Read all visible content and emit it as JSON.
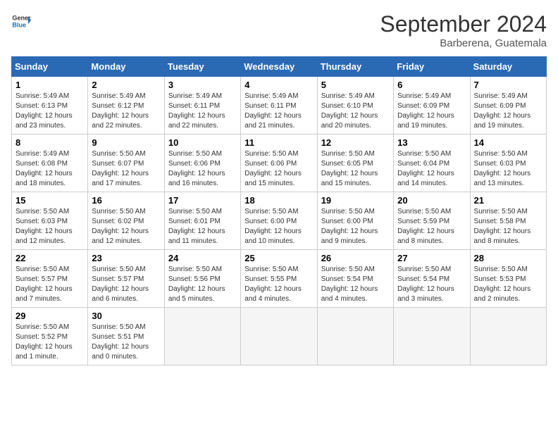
{
  "header": {
    "logo_line1": "General",
    "logo_line2": "Blue",
    "month": "September 2024",
    "location": "Barberena, Guatemala"
  },
  "weekdays": [
    "Sunday",
    "Monday",
    "Tuesday",
    "Wednesday",
    "Thursday",
    "Friday",
    "Saturday"
  ],
  "weeks": [
    [
      {
        "day": "1",
        "info": "Sunrise: 5:49 AM\nSunset: 6:13 PM\nDaylight: 12 hours\nand 23 minutes."
      },
      {
        "day": "2",
        "info": "Sunrise: 5:49 AM\nSunset: 6:12 PM\nDaylight: 12 hours\nand 22 minutes."
      },
      {
        "day": "3",
        "info": "Sunrise: 5:49 AM\nSunset: 6:11 PM\nDaylight: 12 hours\nand 22 minutes."
      },
      {
        "day": "4",
        "info": "Sunrise: 5:49 AM\nSunset: 6:11 PM\nDaylight: 12 hours\nand 21 minutes."
      },
      {
        "day": "5",
        "info": "Sunrise: 5:49 AM\nSunset: 6:10 PM\nDaylight: 12 hours\nand 20 minutes."
      },
      {
        "day": "6",
        "info": "Sunrise: 5:49 AM\nSunset: 6:09 PM\nDaylight: 12 hours\nand 19 minutes."
      },
      {
        "day": "7",
        "info": "Sunrise: 5:49 AM\nSunset: 6:09 PM\nDaylight: 12 hours\nand 19 minutes."
      }
    ],
    [
      {
        "day": "8",
        "info": "Sunrise: 5:49 AM\nSunset: 6:08 PM\nDaylight: 12 hours\nand 18 minutes."
      },
      {
        "day": "9",
        "info": "Sunrise: 5:50 AM\nSunset: 6:07 PM\nDaylight: 12 hours\nand 17 minutes."
      },
      {
        "day": "10",
        "info": "Sunrise: 5:50 AM\nSunset: 6:06 PM\nDaylight: 12 hours\nand 16 minutes."
      },
      {
        "day": "11",
        "info": "Sunrise: 5:50 AM\nSunset: 6:06 PM\nDaylight: 12 hours\nand 15 minutes."
      },
      {
        "day": "12",
        "info": "Sunrise: 5:50 AM\nSunset: 6:05 PM\nDaylight: 12 hours\nand 15 minutes."
      },
      {
        "day": "13",
        "info": "Sunrise: 5:50 AM\nSunset: 6:04 PM\nDaylight: 12 hours\nand 14 minutes."
      },
      {
        "day": "14",
        "info": "Sunrise: 5:50 AM\nSunset: 6:03 PM\nDaylight: 12 hours\nand 13 minutes."
      }
    ],
    [
      {
        "day": "15",
        "info": "Sunrise: 5:50 AM\nSunset: 6:03 PM\nDaylight: 12 hours\nand 12 minutes."
      },
      {
        "day": "16",
        "info": "Sunrise: 5:50 AM\nSunset: 6:02 PM\nDaylight: 12 hours\nand 12 minutes."
      },
      {
        "day": "17",
        "info": "Sunrise: 5:50 AM\nSunset: 6:01 PM\nDaylight: 12 hours\nand 11 minutes."
      },
      {
        "day": "18",
        "info": "Sunrise: 5:50 AM\nSunset: 6:00 PM\nDaylight: 12 hours\nand 10 minutes."
      },
      {
        "day": "19",
        "info": "Sunrise: 5:50 AM\nSunset: 6:00 PM\nDaylight: 12 hours\nand 9 minutes."
      },
      {
        "day": "20",
        "info": "Sunrise: 5:50 AM\nSunset: 5:59 PM\nDaylight: 12 hours\nand 8 minutes."
      },
      {
        "day": "21",
        "info": "Sunrise: 5:50 AM\nSunset: 5:58 PM\nDaylight: 12 hours\nand 8 minutes."
      }
    ],
    [
      {
        "day": "22",
        "info": "Sunrise: 5:50 AM\nSunset: 5:57 PM\nDaylight: 12 hours\nand 7 minutes."
      },
      {
        "day": "23",
        "info": "Sunrise: 5:50 AM\nSunset: 5:57 PM\nDaylight: 12 hours\nand 6 minutes."
      },
      {
        "day": "24",
        "info": "Sunrise: 5:50 AM\nSunset: 5:56 PM\nDaylight: 12 hours\nand 5 minutes."
      },
      {
        "day": "25",
        "info": "Sunrise: 5:50 AM\nSunset: 5:55 PM\nDaylight: 12 hours\nand 4 minutes."
      },
      {
        "day": "26",
        "info": "Sunrise: 5:50 AM\nSunset: 5:54 PM\nDaylight: 12 hours\nand 4 minutes."
      },
      {
        "day": "27",
        "info": "Sunrise: 5:50 AM\nSunset: 5:54 PM\nDaylight: 12 hours\nand 3 minutes."
      },
      {
        "day": "28",
        "info": "Sunrise: 5:50 AM\nSunset: 5:53 PM\nDaylight: 12 hours\nand 2 minutes."
      }
    ],
    [
      {
        "day": "29",
        "info": "Sunrise: 5:50 AM\nSunset: 5:52 PM\nDaylight: 12 hours\nand 1 minute."
      },
      {
        "day": "30",
        "info": "Sunrise: 5:50 AM\nSunset: 5:51 PM\nDaylight: 12 hours\nand 0 minutes."
      },
      {
        "day": "",
        "info": ""
      },
      {
        "day": "",
        "info": ""
      },
      {
        "day": "",
        "info": ""
      },
      {
        "day": "",
        "info": ""
      },
      {
        "day": "",
        "info": ""
      }
    ]
  ]
}
